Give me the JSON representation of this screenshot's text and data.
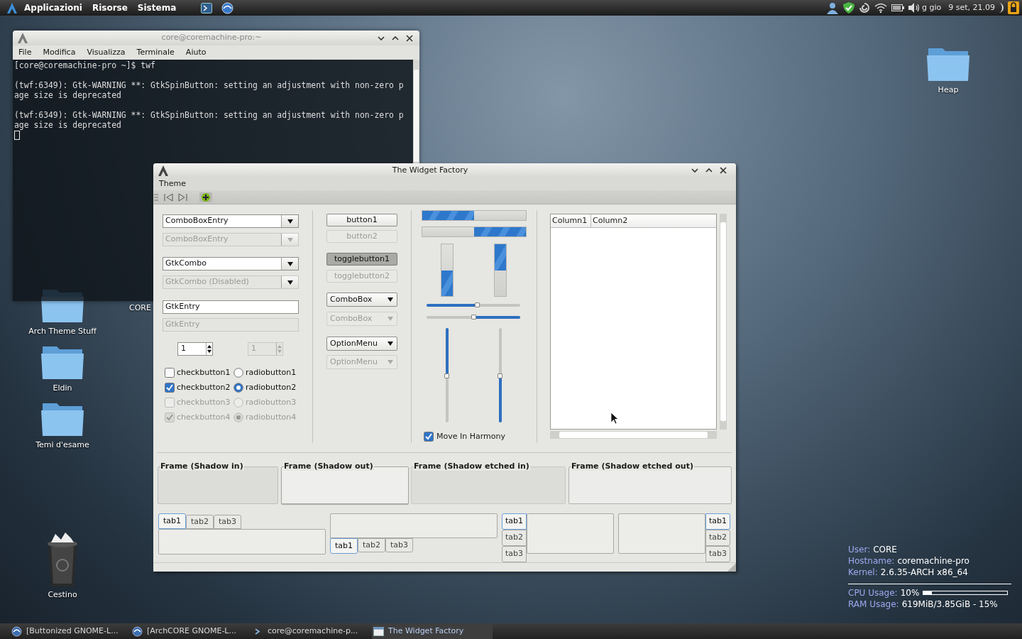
{
  "top_panel": {
    "menus": [
      "Applicazioni",
      "Risorse",
      "Sistema"
    ],
    "user": "g gio",
    "clock": "9 set, 21.09"
  },
  "desktop_icons": [
    {
      "label": "Arch Theme Stuff",
      "kind": "folder"
    },
    {
      "label": "Eldin",
      "kind": "folder"
    },
    {
      "label": "Temi d'esame",
      "kind": "folder"
    },
    {
      "label": "Cestino",
      "kind": "trash"
    },
    {
      "label": "Heap",
      "kind": "folder"
    },
    {
      "label": "CORE",
      "kind": "covered"
    }
  ],
  "terminal": {
    "title": "core@coremachine-pro:~",
    "menu": [
      "File",
      "Modifica",
      "Visualizza",
      "Terminale",
      "Aiuto"
    ],
    "blocks": [
      [
        "[core@coremachine-pro ~]$ twf"
      ],
      [
        "(twf:6349): Gtk-WARNING **: GtkSpinButton: setting an adjustment with non-zero p",
        "age size is deprecated"
      ],
      [
        "(twf:6349): Gtk-WARNING **: GtkSpinButton: setting an adjustment with non-zero p",
        "age size is deprecated"
      ]
    ]
  },
  "widget_factory": {
    "title": "The Widget Factory",
    "menu": [
      "Theme"
    ],
    "combos": [
      {
        "kind": "combo_entry",
        "value": "ComboBoxEntry",
        "disabled": false
      },
      {
        "kind": "combo_entry",
        "value": "ComboBoxEntry",
        "disabled": true
      },
      {
        "kind": "gtk_combo",
        "value": "GtkCombo",
        "disabled": false
      },
      {
        "kind": "gtk_combo",
        "value": "GtkCombo (Disabled)",
        "disabled": true
      },
      {
        "kind": "entry",
        "value": "GtkEntry",
        "disabled": false
      },
      {
        "kind": "entry",
        "value": "GtkEntry",
        "disabled": true
      }
    ],
    "spin_buttons": [
      {
        "value": "1",
        "disabled": false
      },
      {
        "value": "1",
        "disabled": true
      }
    ],
    "checks": [
      {
        "label": "checkbutton1",
        "checked": false,
        "disabled": false
      },
      {
        "label": "checkbutton2",
        "checked": true,
        "disabled": false
      },
      {
        "label": "checkbutton3",
        "checked": false,
        "disabled": true
      },
      {
        "label": "checkbutton4",
        "checked": true,
        "disabled": true
      }
    ],
    "radios": [
      {
        "label": "radiobutton1",
        "selected": false,
        "disabled": false
      },
      {
        "label": "radiobutton2",
        "selected": true,
        "disabled": false
      },
      {
        "label": "radiobutton3",
        "selected": false,
        "disabled": true
      },
      {
        "label": "radiobutton4",
        "selected": true,
        "disabled": true
      }
    ],
    "buttons": [
      {
        "kind": "button",
        "label": "button1",
        "disabled": false,
        "active": false
      },
      {
        "kind": "button",
        "label": "button2",
        "disabled": true,
        "active": false
      },
      {
        "kind": "toggle",
        "label": "togglebutton1",
        "disabled": false,
        "active": true
      },
      {
        "kind": "toggle",
        "label": "togglebutton2",
        "disabled": true,
        "active": false
      },
      {
        "kind": "combo",
        "label": "ComboBox",
        "disabled": false,
        "active": false
      },
      {
        "kind": "combo",
        "label": "ComboBox",
        "disabled": true,
        "active": false
      },
      {
        "kind": "option_menu",
        "label": "OptionMenu",
        "disabled": false,
        "active": false
      },
      {
        "kind": "option_menu",
        "label": "OptionMenu",
        "disabled": true,
        "active": false
      }
    ],
    "progress_bars": [
      {
        "kind": "horizontal",
        "level": 0.5,
        "inverted": false
      },
      {
        "kind": "horizontal",
        "level": 0.5,
        "inverted": true
      },
      {
        "kind": "vertical",
        "level": 0.5,
        "inverted": false
      },
      {
        "kind": "vertical",
        "level": 0.5,
        "inverted": true
      }
    ],
    "sliders": [
      {
        "kind": "horizontal",
        "level": 0.54,
        "inverted": false
      },
      {
        "kind": "horizontal",
        "level": 0.5,
        "inverted": true
      },
      {
        "kind": "vertical",
        "level": 0.5,
        "inverted": false
      },
      {
        "kind": "vertical",
        "level": 0.5,
        "inverted": true
      }
    ],
    "harmony": {
      "label": "Move In Harmony",
      "checked": true
    },
    "tree": {
      "columns": [
        "Column1",
        "Column2"
      ]
    },
    "frames": [
      {
        "label": "Frame (Shadow in)",
        "kind": "in"
      },
      {
        "label": "Frame (Shadow out)",
        "kind": "out"
      },
      {
        "label": "Frame (Shadow etched in)",
        "kind": "etched_in"
      },
      {
        "label": "Frame (Shadow etched out)",
        "kind": "etched_out"
      }
    ],
    "notebooks": [
      {
        "kind": "top",
        "tabs": [
          {
            "label": "tab1",
            "selected": true
          },
          {
            "label": "tab2",
            "selected": false
          },
          {
            "label": "tab3",
            "selected": false
          }
        ]
      },
      {
        "kind": "bottom",
        "tabs": [
          {
            "label": "tab1",
            "selected": true
          },
          {
            "label": "tab2",
            "selected": false
          },
          {
            "label": "tab3",
            "selected": false
          }
        ]
      },
      {
        "kind": "left",
        "tabs": [
          {
            "label": "tab1",
            "selected": true
          },
          {
            "label": "tab2",
            "selected": false
          },
          {
            "label": "tab3",
            "selected": false
          }
        ]
      },
      {
        "kind": "right",
        "tabs": [
          {
            "label": "tab1",
            "selected": true
          },
          {
            "label": "tab2",
            "selected": false
          },
          {
            "label": "tab3",
            "selected": false
          }
        ]
      }
    ]
  },
  "conky": {
    "rows": [
      {
        "label": "User:",
        "value": "CORE"
      },
      {
        "label": "Hostname:",
        "value": "coremachine-pro"
      },
      {
        "label": "Kernel:",
        "value": "2.6.35-ARCH x86_64"
      }
    ],
    "cpu": {
      "label": "CPU Usage:",
      "value": "10%",
      "level": 0.1
    },
    "ram": {
      "label": "RAM Usage:",
      "value": "619MiB/3.85GiB - 15%"
    }
  },
  "taskbar": [
    {
      "label": "[Buttonized GNOME-L...",
      "kind": "browser",
      "selected": false
    },
    {
      "label": "[ArchCORE GNOME-L...",
      "kind": "browser",
      "selected": false
    },
    {
      "label": "core@coremachine-p...",
      "kind": "terminal",
      "selected": false
    },
    {
      "label": "The Widget Factory",
      "kind": "window",
      "selected": true
    }
  ]
}
